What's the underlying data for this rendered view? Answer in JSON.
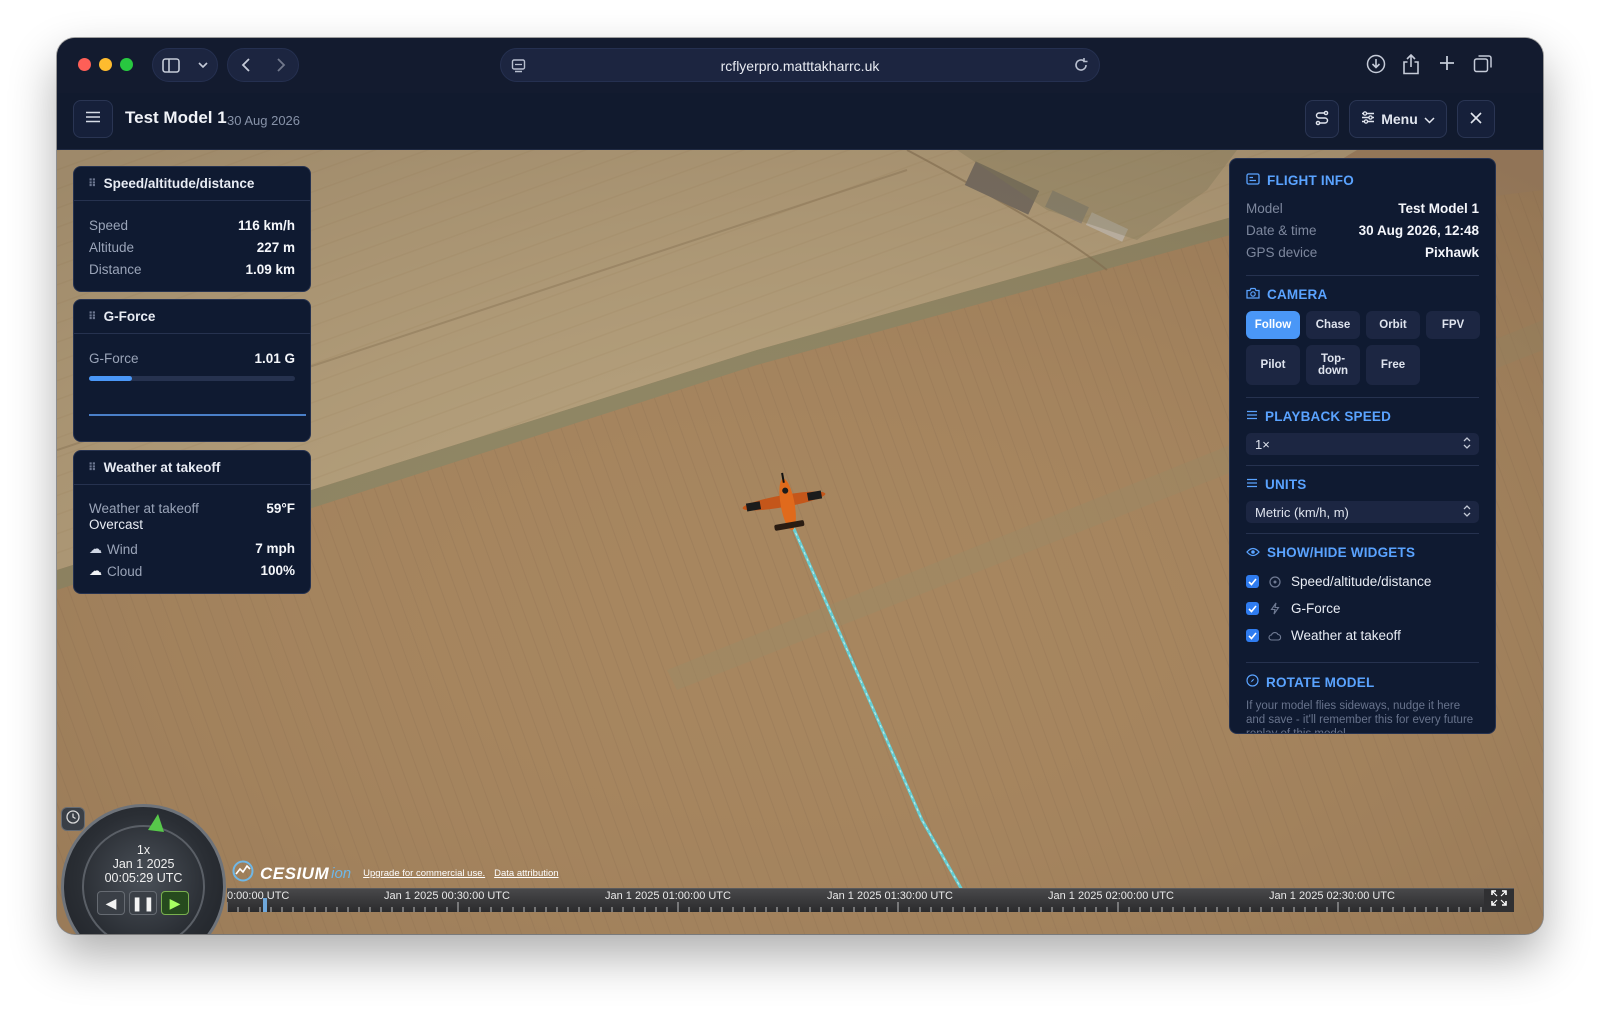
{
  "browser": {
    "url": "rcflyerpro.matttakharrc.uk"
  },
  "header": {
    "title": "Test Model 1",
    "date": "30 Aug 2026",
    "menu_label": "Menu"
  },
  "widgets": {
    "speed": {
      "title": "Speed/altitude/distance",
      "rows": [
        {
          "label": "Speed",
          "value": "116 km/h"
        },
        {
          "label": "Altitude",
          "value": "227 m"
        },
        {
          "label": "Distance",
          "value": "1.09 km"
        }
      ]
    },
    "gforce": {
      "title": "G-Force",
      "label": "G-Force",
      "value": "1.01 G",
      "bar_fraction": 0.21
    },
    "weather": {
      "title": "Weather at takeoff",
      "label": "Weather at takeoff",
      "temp": "59°F",
      "condition": "Overcast",
      "wind_label": "Wind",
      "wind_value": "7 mph",
      "cloud_label": "Cloud",
      "cloud_value": "100%"
    }
  },
  "panel": {
    "flight_info": {
      "title": "FLIGHT INFO",
      "rows": [
        {
          "label": "Model",
          "value": "Test Model 1"
        },
        {
          "label": "Date & time",
          "value": "30 Aug 2026, 12:48"
        },
        {
          "label": "GPS device",
          "value": "Pixhawk"
        }
      ]
    },
    "camera": {
      "title": "CAMERA",
      "buttons": [
        "Follow",
        "Chase",
        "Orbit",
        "FPV",
        "Pilot",
        "Top-down",
        "Free"
      ],
      "active": "Follow"
    },
    "playback": {
      "title": "PLAYBACK SPEED",
      "value": "1×"
    },
    "units": {
      "title": "UNITS",
      "value": "Metric (km/h, m)"
    },
    "widgets_toggle": {
      "title": "SHOW/HIDE WIDGETS",
      "items": [
        {
          "label": "Speed/altitude/distance",
          "checked": true,
          "icon": "gauge-icon"
        },
        {
          "label": "G-Force",
          "checked": true,
          "icon": "bolt-icon"
        },
        {
          "label": "Weather at takeoff",
          "checked": true,
          "icon": "cloud-icon"
        }
      ]
    },
    "rotate": {
      "title": "ROTATE MODEL",
      "text": "If your model flies sideways, nudge it here and save - it'll remember this for every future replay of this model."
    }
  },
  "cesium": {
    "speed": "1x",
    "date": "Jan 1 2025",
    "time": "00:05:29 UTC",
    "logo": "CESIUM",
    "logo_suffix": "ion",
    "upgrade_link": "Upgrade for commercial use.",
    "attribution_link": "Data attribution",
    "timeline_labels": [
      "0:00:00 UTC",
      "Jan 1 2025 00:30:00 UTC",
      "Jan 1 2025 01:00:00 UTC",
      "Jan 1 2025 01:30:00 UTC",
      "Jan 1 2025 02:00:00 UTC",
      "Jan 1 2025 02:30:00 UTC"
    ]
  },
  "colors": {
    "accent": "#4a97f7",
    "section_title": "#5aa3ff",
    "panel_bg": "#0f1a31",
    "flight_path": "#5fd6e0",
    "plane": "#e06a1c"
  }
}
